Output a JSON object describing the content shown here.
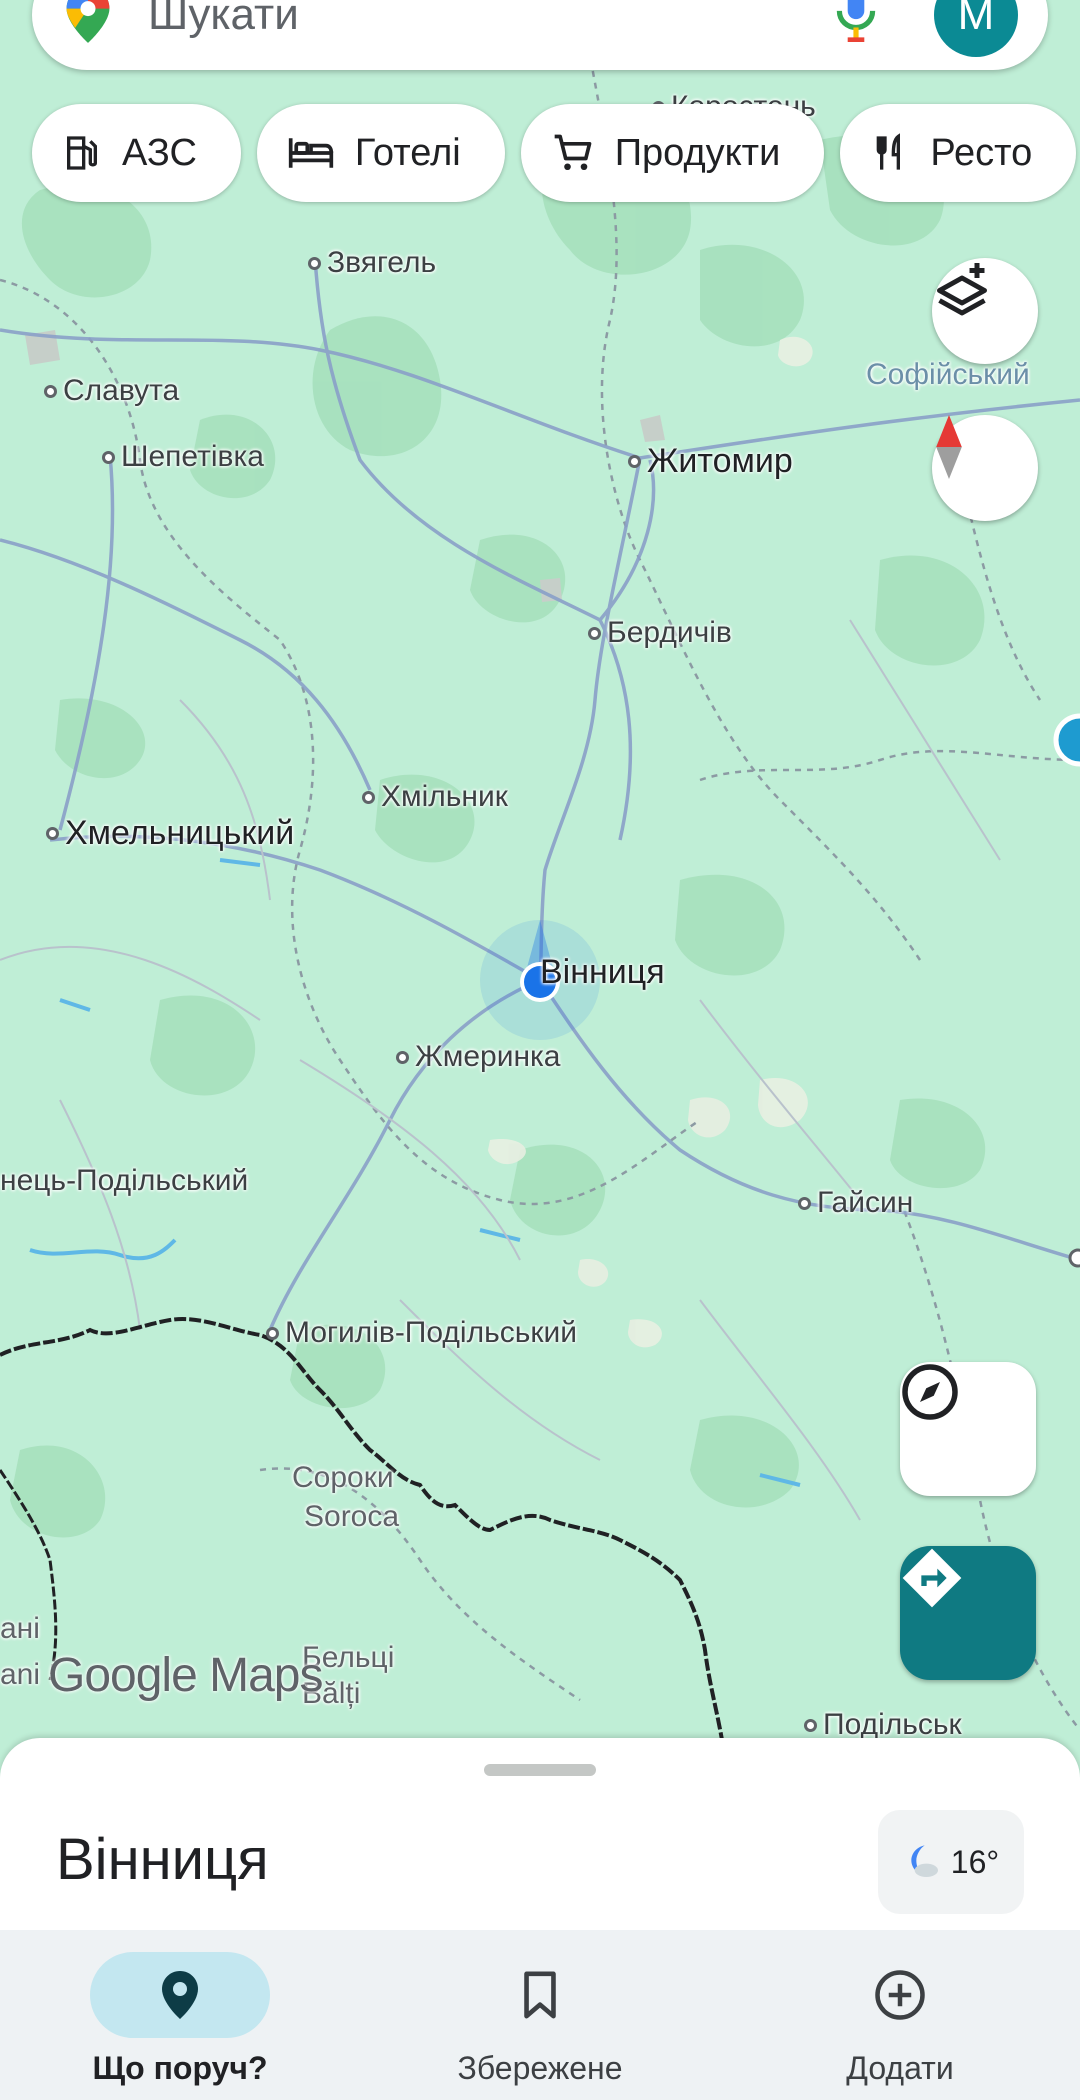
{
  "search": {
    "placeholder": "Шукати",
    "avatar_letter": "M"
  },
  "chips": [
    {
      "label": "АЗС",
      "icon": "gas-station-icon"
    },
    {
      "label": "Готелі",
      "icon": "bed-icon"
    },
    {
      "label": "Продукти",
      "icon": "cart-icon"
    },
    {
      "label": "Ресто",
      "icon": "restaurant-icon"
    }
  ],
  "map": {
    "cities": [
      {
        "name": "Коростень"
      },
      {
        "name": "Звягель"
      },
      {
        "name": "Славута"
      },
      {
        "name": "Шепетівка"
      },
      {
        "name": "Житомир"
      },
      {
        "name": "Софійський"
      },
      {
        "name": "Бердичів"
      },
      {
        "name": "Хмільник"
      },
      {
        "name": "Хмельницький"
      },
      {
        "name": "Вінниця"
      },
      {
        "name": "Жмеринка"
      },
      {
        "name": "нець-Подільський"
      },
      {
        "name": "Гайсин"
      },
      {
        "name": "Могилів-Подільський"
      },
      {
        "name": "Сороки"
      },
      {
        "name": "Soroca"
      },
      {
        "name": "ані"
      },
      {
        "name": "ani"
      },
      {
        "name": "Бельці"
      },
      {
        "name": "Bălți"
      },
      {
        "name": "Подільськ"
      }
    ],
    "watermark": "Google Maps"
  },
  "sheet": {
    "title": "Вінниця",
    "temperature": "16°"
  },
  "nav": [
    {
      "label": "Що поруч?",
      "active": true
    },
    {
      "label": "Збережене",
      "active": false
    },
    {
      "label": "Додати",
      "active": false
    }
  ],
  "colors": {
    "map_bg": "#bfeed6",
    "forest": "#a6e0bd",
    "accent": "#0f7a82",
    "location": "#1a73e8"
  }
}
